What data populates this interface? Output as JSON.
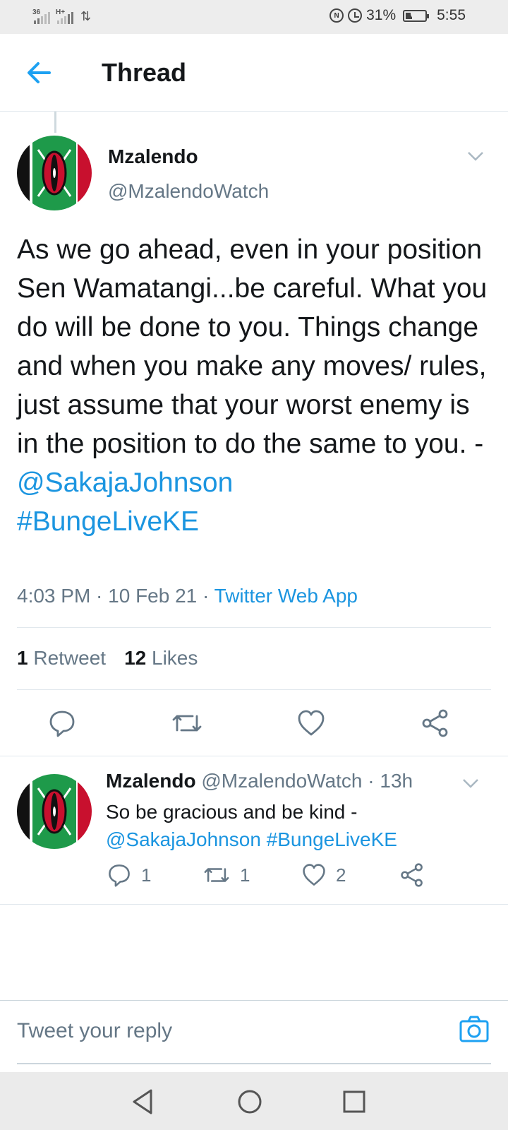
{
  "status_bar": {
    "signal1_label": "36",
    "signal2_label": "H+",
    "battery_percent": "31%",
    "time": "5:55"
  },
  "header": {
    "title": "Thread"
  },
  "main_tweet": {
    "author_name": "Mzalendo",
    "author_handle": "@MzalendoWatch",
    "text_plain": "As we go ahead, even in your position Sen Wamatangi...be careful. What you do will be done to you. Things change and when you make any moves/ rules, just assume that your worst enemy is in the position to do the same to you. - ",
    "mention": "@SakajaJohnson",
    "hashtag": "#BungeLiveKE",
    "timestamp": "4:03 PM · 10 Feb 21 · ",
    "source": "Twitter Web App",
    "retweet_count": "1",
    "retweet_label": "Retweet",
    "like_count": "12",
    "like_label": "Likes"
  },
  "reply_tweet": {
    "author_name": "Mzalendo",
    "author_handle": "@MzalendoWatch · 13h",
    "text_plain": "So be gracious and be kind -",
    "mention": "@SakajaJohnson",
    "hashtag": "#BungeLiveKE",
    "reply_count": "1",
    "retweet_count": "1",
    "like_count": "2"
  },
  "composer": {
    "placeholder": "Tweet your reply"
  },
  "colors": {
    "accent": "#1b95e0",
    "text": "#14171a",
    "secondary": "#657786"
  }
}
